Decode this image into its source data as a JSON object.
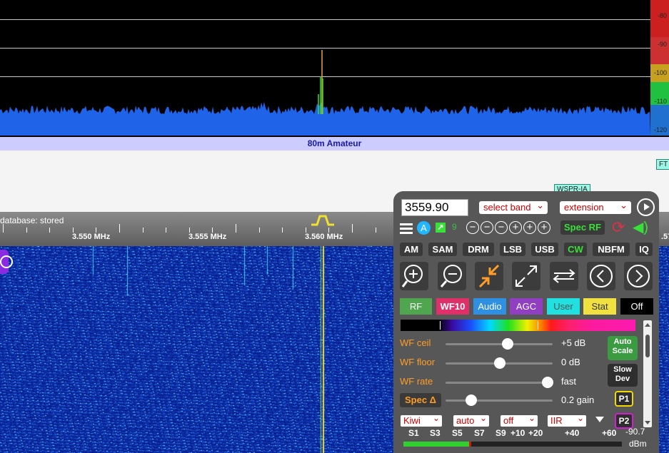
{
  "spectrum": {
    "db_scale": [
      "-80",
      "-90",
      "-100",
      "-110",
      "-120"
    ],
    "scale_colors": [
      "#cc2020",
      "#cc3030",
      "#c8a020",
      "#20c040",
      "#2070d0"
    ]
  },
  "band_bar": {
    "label": "80m Amateur"
  },
  "label_strip": {
    "tags": [
      "WSPR-IA",
      "FT"
    ]
  },
  "scale_bar": {
    "db_status": "database: stored",
    "freq_labels": [
      "3.550 MHz",
      "3.555 MHz",
      "3.560 MHz"
    ],
    "right_fragment": ".57"
  },
  "panel": {
    "frequency": "3559.90",
    "band_select": "select band",
    "extension_select": "extension",
    "badge": "A",
    "num_9": "9",
    "spec_rf": "Spec RF",
    "modes": [
      "AM",
      "SAM",
      "DRM",
      "LSB",
      "USB",
      "CW",
      "NBFM",
      "IQ"
    ],
    "active_mode": "CW",
    "tabs": [
      "RF",
      "WF10",
      "Audio",
      "AGC",
      "User",
      "Stat",
      "Off"
    ],
    "tab_colors": [
      "#4fa64f",
      "#e0306a",
      "#2f8fe0",
      "#8f3fbf",
      "#20e0e0",
      "#f0e040",
      "#000000"
    ],
    "sliders": {
      "wf_ceil": {
        "label": "WF ceil",
        "value": "+5 dB"
      },
      "wf_floor": {
        "label": "WF floor",
        "value": "0 dB"
      },
      "wf_rate": {
        "label": "WF rate",
        "value": "fast"
      },
      "spec_gain": {
        "value": "0.2 gain"
      }
    },
    "spec_delta": "Spec Δ",
    "auto_scale": [
      "Auto",
      "Scale"
    ],
    "slow_dev": [
      "Slow",
      "Dev"
    ],
    "p1": "P1",
    "p2": "P2",
    "bottom_selects": [
      "Kiwi",
      "auto",
      "off",
      "IIR"
    ],
    "smeter": {
      "labels": [
        "S1",
        "S3",
        "S5",
        "S7",
        "S9",
        "+10",
        "+20",
        "+40",
        "+60"
      ],
      "value": "-90.7",
      "unit": "dBm"
    }
  }
}
